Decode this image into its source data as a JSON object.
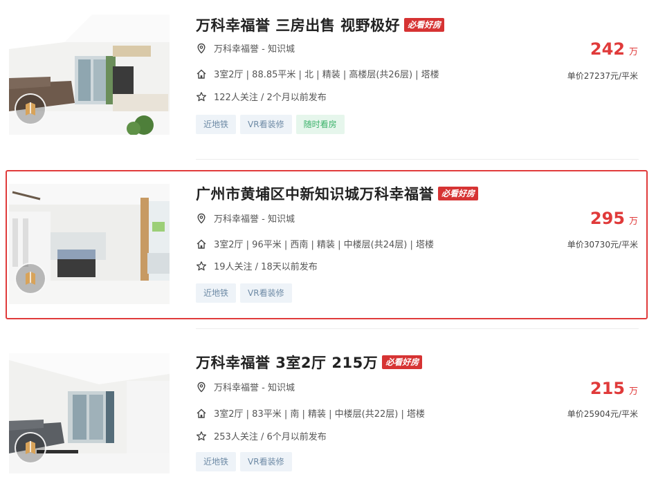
{
  "listings": [
    {
      "title": "万科幸福誉 三房出售 视野极好",
      "badge": "必看好房",
      "location": "万科幸福誉 - 知识城",
      "house_info": "3室2厅 | 88.85平米 | 北 | 精装 | 高楼层(共26层) | 塔楼",
      "follow_info": "122人关注 / 2个月以前发布",
      "tags": [
        "近地铁",
        "VR看装修",
        "随时看房"
      ],
      "price": "242",
      "price_unit": "万",
      "unit_price": "单价27237元/平米"
    },
    {
      "title": "广州市黄埔区中新知识城万科幸福誉",
      "badge": "必看好房",
      "location": "万科幸福誉 - 知识城",
      "house_info": "3室2厅 | 96平米 | 西南 | 精装 | 中楼层(共24层) | 塔楼",
      "follow_info": "19人关注 / 18天以前发布",
      "tags": [
        "近地铁",
        "VR看装修"
      ],
      "price": "295",
      "price_unit": "万",
      "unit_price": "单价30730元/平米"
    },
    {
      "title": "万科幸福誉 3室2厅 215万",
      "badge": "必看好房",
      "location": "万科幸福誉 - 知识城",
      "house_info": "3室2厅 | 83平米 | 南 | 精装 | 中楼层(共22层) | 塔楼",
      "follow_info": "253人关注 / 6个月以前发布",
      "tags": [
        "近地铁",
        "VR看装修"
      ],
      "price": "215",
      "price_unit": "万",
      "unit_price": "单价25904元/平米"
    }
  ],
  "colors": {
    "accent_red": "#e03a3a",
    "badge_red": "#d63333",
    "tag_blue": "#6d8aa5",
    "tag_green": "#3bb26a"
  },
  "icons": {
    "location": "location-pin-icon",
    "house": "house-icon",
    "follow": "star-icon",
    "vr": "vr-badge-icon"
  }
}
